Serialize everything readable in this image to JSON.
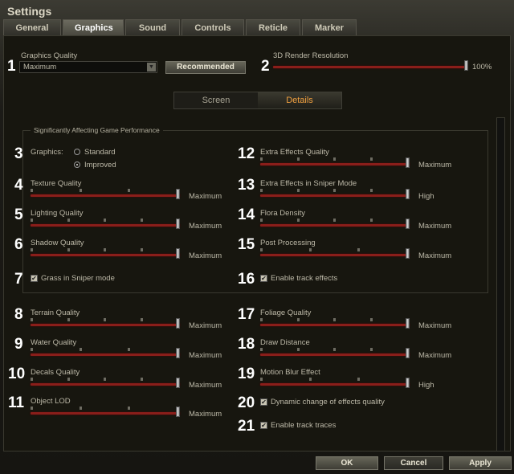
{
  "window_title": "Settings",
  "tabs": [
    {
      "label": "General"
    },
    {
      "label": "Graphics",
      "active": true
    },
    {
      "label": "Sound"
    },
    {
      "label": "Controls"
    },
    {
      "label": "Reticle"
    },
    {
      "label": "Marker"
    }
  ],
  "top": {
    "graphics_quality_label": "Graphics Quality",
    "graphics_quality_value": "Maximum",
    "recommended_label": "Recommended",
    "render_res_label": "3D Render Resolution",
    "render_res_value": "100%",
    "render_res_fraction": 1.0,
    "num1": "1",
    "num2": "2"
  },
  "subtabs": {
    "screen": "Screen",
    "details": "Details",
    "active": "details"
  },
  "group_title": "Significantly Affecting Game Performance",
  "graphics_mode": {
    "num": "3",
    "label": "Graphics:",
    "options": [
      "Standard",
      "Improved"
    ],
    "selected": "Improved"
  },
  "sliders": [
    {
      "num": "4",
      "label": "Texture Quality",
      "value": "Maximum",
      "levels": 4,
      "fraction": 1.0,
      "col": 0,
      "row": 1
    },
    {
      "num": "5",
      "label": "Lighting Quality",
      "value": "Maximum",
      "levels": 5,
      "fraction": 1.0,
      "col": 0,
      "row": 2
    },
    {
      "num": "6",
      "label": "Shadow Quality",
      "value": "Maximum",
      "levels": 5,
      "fraction": 1.0,
      "col": 0,
      "row": 3
    },
    {
      "num": "8",
      "label": "Terrain Quality",
      "value": "Maximum",
      "levels": 5,
      "fraction": 1.0,
      "col": 0,
      "row": 5
    },
    {
      "num": "9",
      "label": "Water Quality",
      "value": "Maximum",
      "levels": 4,
      "fraction": 1.0,
      "col": 0,
      "row": 6
    },
    {
      "num": "10",
      "label": "Decals Quality",
      "value": "Maximum",
      "levels": 5,
      "fraction": 1.0,
      "col": 0,
      "row": 7
    },
    {
      "num": "11",
      "label": "Object LOD",
      "value": "Maximum",
      "levels": 4,
      "fraction": 1.0,
      "col": 0,
      "row": 8
    },
    {
      "num": "12",
      "label": "Extra Effects Quality",
      "value": "Maximum",
      "levels": 5,
      "fraction": 1.0,
      "col": 1,
      "row": 0
    },
    {
      "num": "13",
      "label": "Extra Effects in Sniper Mode",
      "value": "High",
      "levels": 5,
      "fraction": 1.0,
      "col": 1,
      "row": 1
    },
    {
      "num": "14",
      "label": "Flora Density",
      "value": "Maximum",
      "levels": 5,
      "fraction": 1.0,
      "col": 1,
      "row": 2
    },
    {
      "num": "15",
      "label": "Post Processing",
      "value": "Maximum",
      "levels": 4,
      "fraction": 1.0,
      "col": 1,
      "row": 3
    },
    {
      "num": "17",
      "label": "Foliage Quality",
      "value": "Maximum",
      "levels": 5,
      "fraction": 1.0,
      "col": 1,
      "row": 5
    },
    {
      "num": "18",
      "label": "Draw Distance",
      "value": "Maximum",
      "levels": 5,
      "fraction": 1.0,
      "col": 1,
      "row": 6
    },
    {
      "num": "19",
      "label": "Motion Blur Effect",
      "value": "High",
      "levels": 4,
      "fraction": 1.0,
      "col": 1,
      "row": 7
    }
  ],
  "checkboxes": [
    {
      "num": "7",
      "label": "Grass in Sniper mode",
      "checked": true,
      "col": 0,
      "row": 4
    },
    {
      "num": "16",
      "label": "Enable track effects",
      "checked": true,
      "col": 1,
      "row": 4
    },
    {
      "num": "20",
      "label": "Dynamic change of effects quality",
      "checked": true,
      "col": 1,
      "row": 8
    },
    {
      "num": "21",
      "label": "Enable track traces",
      "checked": true,
      "col": 1,
      "row": 9
    }
  ],
  "buttons": {
    "ok": "OK",
    "cancel": "Cancel",
    "apply": "Apply"
  }
}
